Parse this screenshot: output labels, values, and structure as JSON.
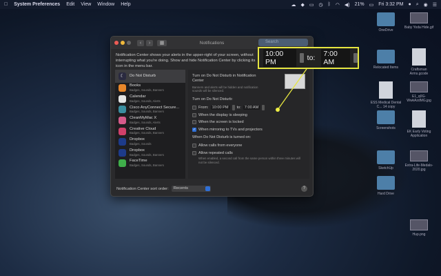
{
  "menubar": {
    "apple": "",
    "app": "System Preferences",
    "items": [
      "Edit",
      "View",
      "Window",
      "Help"
    ],
    "battery": "21%",
    "clock": "Fri 3:32 PM"
  },
  "window": {
    "title": "Notifications",
    "search_placeholder": "Search",
    "description": "Notification Center shows your alerts in the upper-right of your screen, without interrupting what you're doing. Show and hide Notification Center by clicking its icon in the menu bar.",
    "sidebar": [
      {
        "name": "Do Not Disturb",
        "sub": "",
        "icon": "moon-icon",
        "color": "#2a2a40",
        "selected": true
      },
      {
        "name": "Books",
        "sub": "Badges, Sounds, Banners",
        "icon": "books-icon",
        "color": "#e8872a"
      },
      {
        "name": "Calendar",
        "sub": "Badges, Sounds, Alerts",
        "icon": "calendar-icon",
        "color": "#e5e5e5"
      },
      {
        "name": "Cisco AnyConnect Secure...",
        "sub": "Badges, Sounds, Banners",
        "icon": "cisco-icon",
        "color": "#3a8ea0"
      },
      {
        "name": "CleanMyMac X",
        "sub": "Badges, Sounds, Alerts",
        "icon": "cleanmymac-icon",
        "color": "#d65a8a"
      },
      {
        "name": "Creative Cloud",
        "sub": "Badges, Sounds, Banners",
        "icon": "creative-cloud-icon",
        "color": "#d0406a"
      },
      {
        "name": "Dropbox",
        "sub": "Badges, Sounds",
        "icon": "dropbox-icon",
        "color": "#1d3b8a"
      },
      {
        "name": "Dropbox",
        "sub": "Badges, Sounds, Banners",
        "icon": "dropbox-icon",
        "color": "#1d3b8a"
      },
      {
        "name": "FaceTime",
        "sub": "Badges, Sounds, Banners",
        "icon": "facetime-icon",
        "color": "#3fae4a"
      }
    ],
    "pane": {
      "heading": "Turn on Do Not Disturb in Notification Center",
      "heading_note": "Banners and alerts will be hidden and notification sounds will be silenced.",
      "schedule_label": "Turn on Do Not Disturb:",
      "from_label": "From:",
      "from": "10:00 PM",
      "to_label": "to:",
      "to": "7:00 AM",
      "options": [
        {
          "label": "When the display is sleeping",
          "checked": false
        },
        {
          "label": "When the screen is locked",
          "checked": false
        },
        {
          "label": "When mirroring to TVs and projectors",
          "checked": true
        }
      ],
      "when_on_label": "When Do Not Disturb is turned on:",
      "calls": [
        {
          "label": "Allow calls from everyone",
          "checked": false
        },
        {
          "label": "Allow repeated calls",
          "checked": false
        }
      ],
      "calls_note": "When enabled, a second call from the same person within three minutes will not be silenced."
    },
    "sort_label": "Notification Center sort order:",
    "sort_value": "Recents",
    "help": "?"
  },
  "callout": {
    "from": "10:00 PM",
    "to_label": "to:",
    "to": "7:00 AM",
    "color": "#e6e640"
  },
  "desktop": [
    "OneDrive",
    "Baby Yoda Hide.gif",
    "Relocated Items",
    "Craftsman Arms.gcode",
    "ESS Medical Dental C... 14 copy",
    "E1_q0G-WwkAzdMG.jpg",
    "Screenshots",
    "EK Early Voting Application",
    "SketchUp",
    "Extra-Life-Medals-2020.jpg",
    "Hard Drive",
    "Hup.png"
  ]
}
